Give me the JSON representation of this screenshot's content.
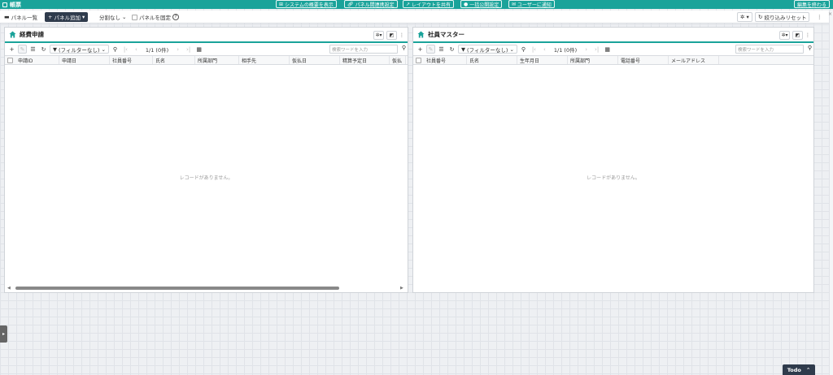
{
  "app": {
    "title": "帳票"
  },
  "topbar": {
    "system_overview": "システムの概要を表示",
    "panel_link_settings": "パネル間連携設定",
    "share_layout": "レイアウトを共有",
    "bulk_publish": "一括公開設定",
    "notify_user": "ユーザーに通知",
    "finish_edit": "編集を終わる"
  },
  "toolbar": {
    "panel_list": "パネル一覧",
    "add_panel": "パネル追加",
    "split": "分割なし",
    "fix_panel": "パネルを固定",
    "reset_filter": "絞り込みリセット"
  },
  "panels": [
    {
      "title": "経費申請",
      "filter": "(フィルターなし)",
      "page_info": "1/1 (0件)",
      "search_placeholder": "検索ワードを入力",
      "columns": [
        "申請ID",
        "申請日",
        "社員番号",
        "氏名",
        "所属部門",
        "相手先",
        "仮払日",
        "精算予定日",
        "仮払"
      ],
      "empty_message": "レコードがありません。"
    },
    {
      "title": "社員マスター",
      "filter": "(フィルターなし)",
      "page_info": "1/1 (0件)",
      "search_placeholder": "検索ワードを入力",
      "columns": [
        "社員番号",
        "氏名",
        "生年月日",
        "所属部門",
        "電話番号",
        "メールアドレス"
      ],
      "empty_message": "レコードがありません。"
    }
  ],
  "todo": {
    "label": "Todo"
  },
  "colors": {
    "accent": "#1aa39a",
    "dark": "#2f3b4c"
  }
}
